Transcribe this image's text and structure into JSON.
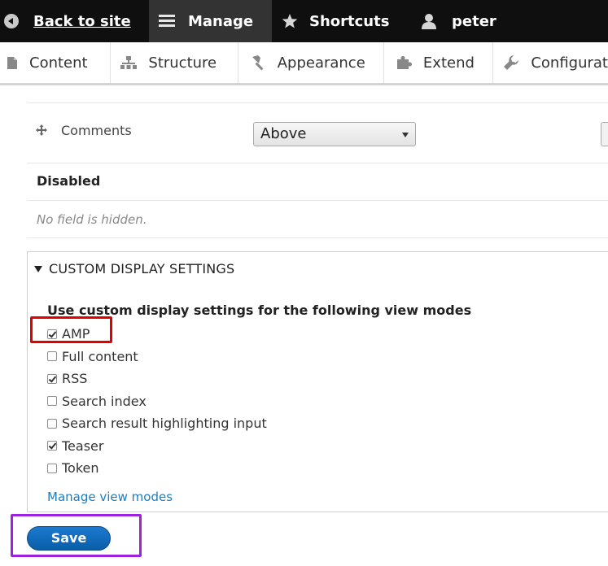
{
  "toolbar": {
    "back_label": "Back to site",
    "manage_label": "Manage",
    "shortcuts_label": "Shortcuts",
    "user_label": "peter"
  },
  "tray": {
    "content": "Content",
    "structure": "Structure",
    "appearance": "Appearance",
    "extend": "Extend",
    "configuration": "Configurat"
  },
  "fields": {
    "comments_label": "Comments",
    "comments_select_value": "Above",
    "disabled_heading": "Disabled",
    "no_hidden": "No field is hidden."
  },
  "custom_display": {
    "summary": "CUSTOM DISPLAY SETTINGS",
    "title": "Use custom display settings for the following view modes",
    "modes": [
      {
        "label": "AMP",
        "checked": true
      },
      {
        "label": "Full content",
        "checked": false
      },
      {
        "label": "RSS",
        "checked": true
      },
      {
        "label": "Search index",
        "checked": false
      },
      {
        "label": "Search result highlighting input",
        "checked": false
      },
      {
        "label": "Teaser",
        "checked": true
      },
      {
        "label": "Token",
        "checked": false
      }
    ],
    "manage_link": "Manage view modes"
  },
  "actions": {
    "save_label": "Save"
  },
  "colors": {
    "toolbar_bg": "#0f0f0f",
    "manage_bg": "#333333",
    "link": "#1f7dbd",
    "save_button": "#0a5ea8",
    "highlight_red": "#e40000",
    "highlight_purple": "#a020e0"
  }
}
